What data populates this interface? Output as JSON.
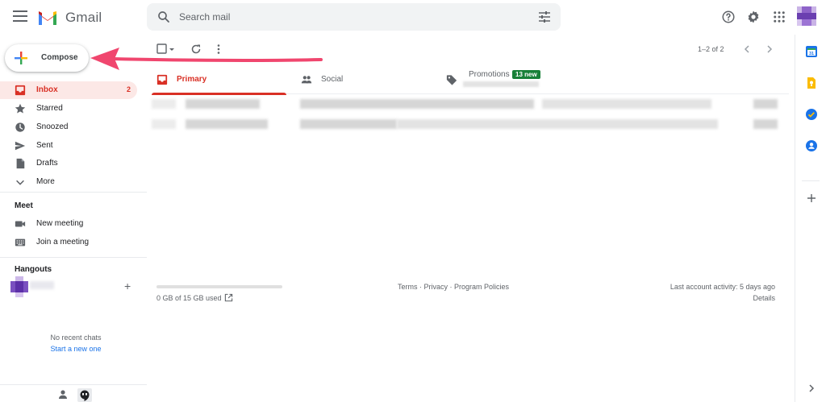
{
  "app": {
    "name": "Gmail"
  },
  "search": {
    "placeholder": "Search mail"
  },
  "header_icons": [
    "help-icon",
    "settings-gear-icon",
    "apps-grid-icon",
    "account-avatar"
  ],
  "compose": {
    "label": "Compose"
  },
  "sidebar": {
    "items": [
      {
        "label": "Inbox",
        "count": "2",
        "icon": "inbox-icon",
        "active": true
      },
      {
        "label": "Starred",
        "count": "",
        "icon": "star-icon",
        "active": false
      },
      {
        "label": "Snoozed",
        "count": "",
        "icon": "clock-icon",
        "active": false
      },
      {
        "label": "Sent",
        "count": "",
        "icon": "send-icon",
        "active": false
      },
      {
        "label": "Drafts",
        "count": "",
        "icon": "draft-icon",
        "active": false
      },
      {
        "label": "More",
        "count": "",
        "icon": "chevron-down-icon",
        "active": false
      }
    ],
    "meet": {
      "title": "Meet",
      "items": [
        {
          "label": "New meeting",
          "icon": "video-camera-icon"
        },
        {
          "label": "Join a meeting",
          "icon": "keyboard-icon"
        }
      ]
    },
    "hangouts": {
      "title": "Hangouts",
      "empty_text": "No recent chats",
      "start_link": "Start a new one"
    }
  },
  "toolbar": {
    "pager": "1–2 of 2"
  },
  "tabs": [
    {
      "label": "Primary",
      "icon": "inbox-tab-icon",
      "active": true
    },
    {
      "label": "Social",
      "icon": "people-icon",
      "active": false
    },
    {
      "label": "Promotions",
      "icon": "tag-icon",
      "active": false,
      "badge": "13 new"
    }
  ],
  "emails_blurred": 2,
  "footer": {
    "storage_used": "0 GB of 15 GB used",
    "storage_fraction": 0.0,
    "terms": "Terms",
    "privacy": "Privacy",
    "program_policies": "Program Policies",
    "sep": " · ",
    "last_activity": "Last account activity: 5 days ago",
    "details": "Details"
  },
  "right_rail": [
    "calendar-icon",
    "keep-icon",
    "tasks-icon",
    "contacts-icon",
    "add-icon",
    "chevron-right-icon"
  ],
  "colors": {
    "accent_red": "#d93025",
    "active_bg": "#fce8e6",
    "promo_badge": "#188038",
    "link_blue": "#1a73e8",
    "annotation_arrow": "#f0466e"
  }
}
